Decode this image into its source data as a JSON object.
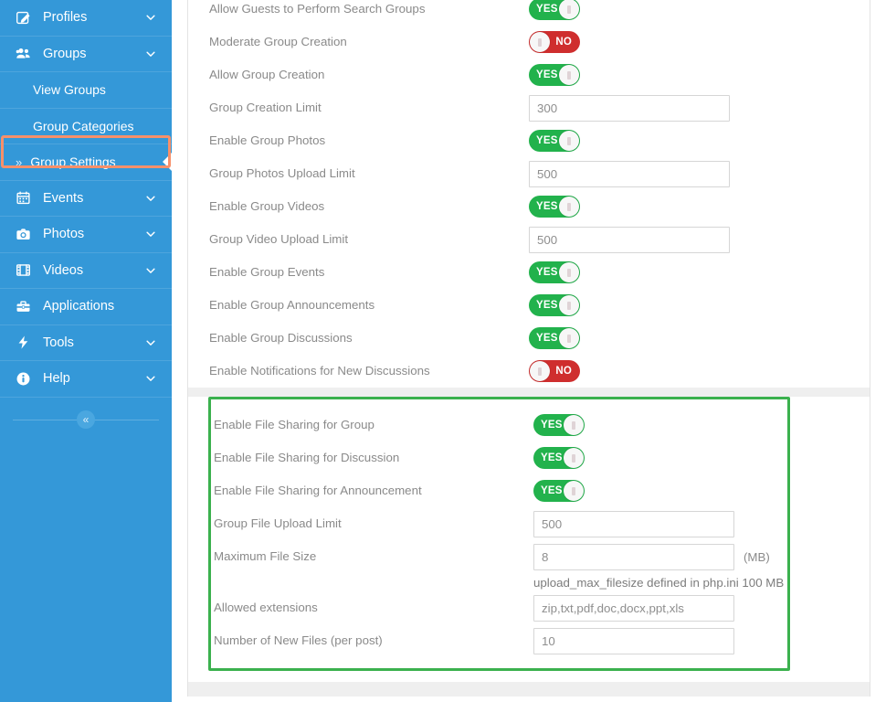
{
  "sidebar": {
    "items": [
      {
        "label": "Profiles",
        "icon": "edit-profile-icon",
        "chevron": true,
        "type": "parent"
      },
      {
        "label": "Groups",
        "icon": "groups-icon",
        "chevron": true,
        "type": "parent"
      },
      {
        "label": "View Groups",
        "icon": "",
        "chevron": false,
        "type": "sub"
      },
      {
        "label": "Group Categories",
        "icon": "",
        "chevron": false,
        "type": "sub"
      },
      {
        "label": "Group Settings",
        "icon": "",
        "chevron": false,
        "type": "sub-active",
        "bullet": "»"
      },
      {
        "label": "Events",
        "icon": "calendar-icon",
        "chevron": true,
        "type": "parent"
      },
      {
        "label": "Photos",
        "icon": "camera-icon",
        "chevron": true,
        "type": "parent"
      },
      {
        "label": "Videos",
        "icon": "film-icon",
        "chevron": true,
        "type": "parent"
      },
      {
        "label": "Applications",
        "icon": "briefcase-icon",
        "chevron": false,
        "type": "parent"
      },
      {
        "label": "Tools",
        "icon": "bolt-icon",
        "chevron": true,
        "type": "parent"
      },
      {
        "label": "Help",
        "icon": "info-icon",
        "chevron": true,
        "type": "parent"
      }
    ],
    "collapse_glyph": "«",
    "background_color": "#3498d8",
    "highlight_color": "#f7906a"
  },
  "settings": {
    "rows": [
      {
        "label": "Allow Guests to Perform Search Groups",
        "control": "toggle",
        "value": "YES"
      },
      {
        "label": "Moderate Group Creation",
        "control": "toggle",
        "value": "NO"
      },
      {
        "label": "Allow Group Creation",
        "control": "toggle",
        "value": "YES"
      },
      {
        "label": "Group Creation Limit",
        "control": "input",
        "value": "300"
      },
      {
        "label": "Enable Group Photos",
        "control": "toggle",
        "value": "YES"
      },
      {
        "label": "Group Photos Upload Limit",
        "control": "input",
        "value": "500"
      },
      {
        "label": "Enable Group Videos",
        "control": "toggle",
        "value": "YES"
      },
      {
        "label": "Group Video Upload Limit",
        "control": "input",
        "value": "500"
      },
      {
        "label": "Enable Group Events",
        "control": "toggle",
        "value": "YES"
      },
      {
        "label": "Enable Group Announcements",
        "control": "toggle",
        "value": "YES"
      },
      {
        "label": "Enable Group Discussions",
        "control": "toggle",
        "value": "YES"
      },
      {
        "label": "Enable Notifications for New Discussions",
        "control": "toggle",
        "value": "NO"
      }
    ]
  },
  "file_sharing_section": {
    "highlight_color": "#3bb14e",
    "rows": [
      {
        "label": "Enable File Sharing for Group",
        "control": "toggle",
        "value": "YES"
      },
      {
        "label": "Enable File Sharing for Discussion",
        "control": "toggle",
        "value": "YES"
      },
      {
        "label": "Enable File Sharing for Announcement",
        "control": "toggle",
        "value": "YES"
      },
      {
        "label": "Group File Upload Limit",
        "control": "input",
        "value": "500"
      },
      {
        "label": "Maximum File Size",
        "control": "input",
        "value": "8",
        "unit": "(MB)",
        "hint": "upload_max_filesize defined in php.ini 100 MB"
      },
      {
        "label": "Allowed extensions",
        "control": "input",
        "value": "zip,txt,pdf,doc,docx,ppt,xls"
      },
      {
        "label": "Number of New Files (per post)",
        "control": "input",
        "value": "10"
      }
    ]
  }
}
